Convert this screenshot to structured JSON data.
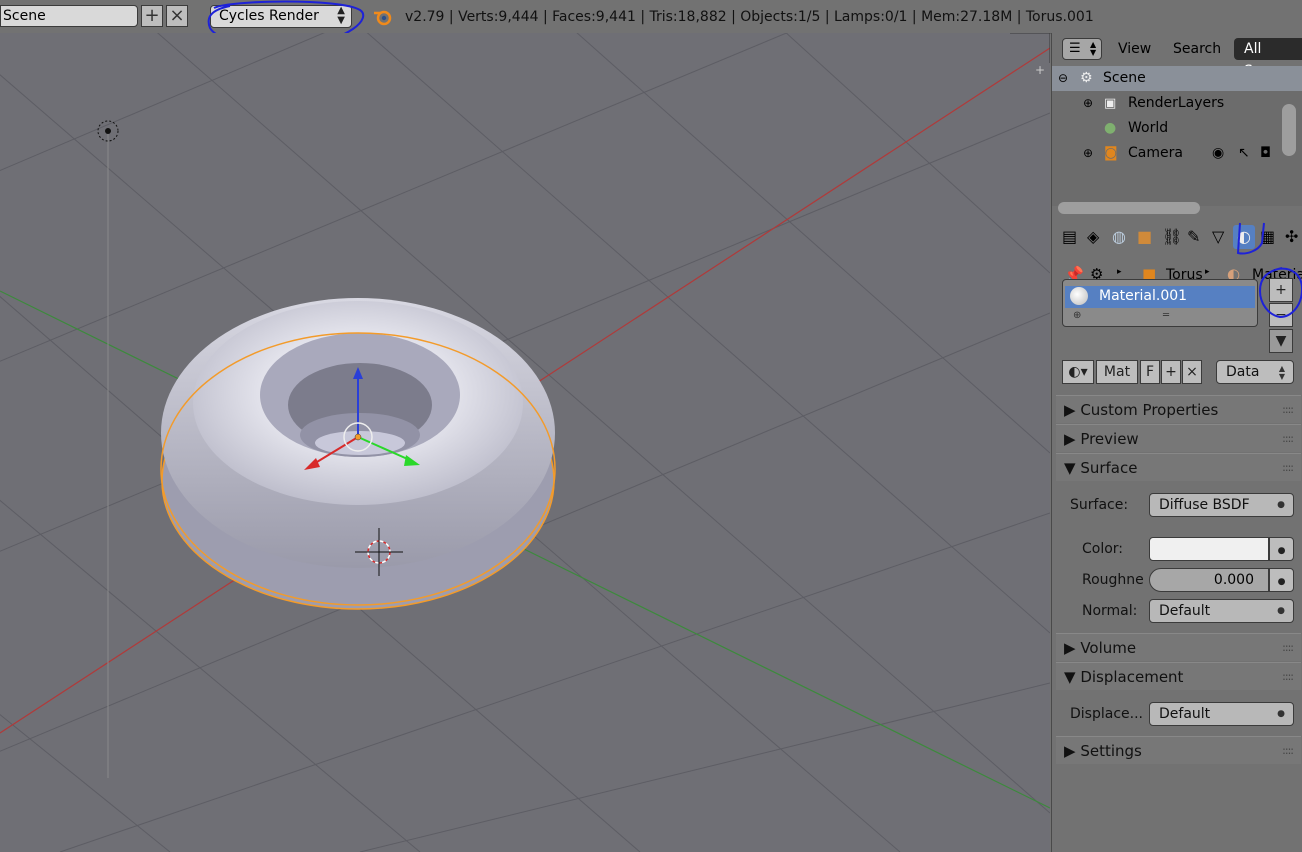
{
  "header": {
    "scene_name": "Scene",
    "render_engine": "Cycles Render",
    "stats": "v2.79 | Verts:9,444 | Faces:9,441 | Tris:18,882 | Objects:1/5 | Lamps:0/1 | Mem:27.18M | Torus.001"
  },
  "outliner": {
    "menu_view": "View",
    "menu_search": "Search",
    "filter": "All Scenes",
    "rows": [
      {
        "label": "Scene"
      },
      {
        "label": "RenderLayers"
      },
      {
        "label": "World"
      },
      {
        "label": "Camera"
      }
    ]
  },
  "properties": {
    "breadcrumb_object": "Torus",
    "breadcrumb_material": "Material",
    "material_slot": "Material.001",
    "datablock_name": "Mat",
    "fake_user_label": "F",
    "link_dropdown": "Data",
    "panels": {
      "custom_properties": "Custom Properties",
      "preview": "Preview",
      "surface": "Surface",
      "volume": "Volume",
      "displacement": "Displacement",
      "settings": "Settings"
    },
    "surface_label": "Surface:",
    "surface_value": "Diffuse BSDF",
    "color_label": "Color:",
    "roughness_label": "Roughne",
    "roughness_value": "0.000",
    "normal_label": "Normal:",
    "normal_value": "Default",
    "displacement_label": "Displace...",
    "displacement_value": "Default"
  },
  "colors": {
    "selection_blue": "#5680c2",
    "annotation_blue": "#1e22d8",
    "object_outline": "#f39b2a"
  }
}
